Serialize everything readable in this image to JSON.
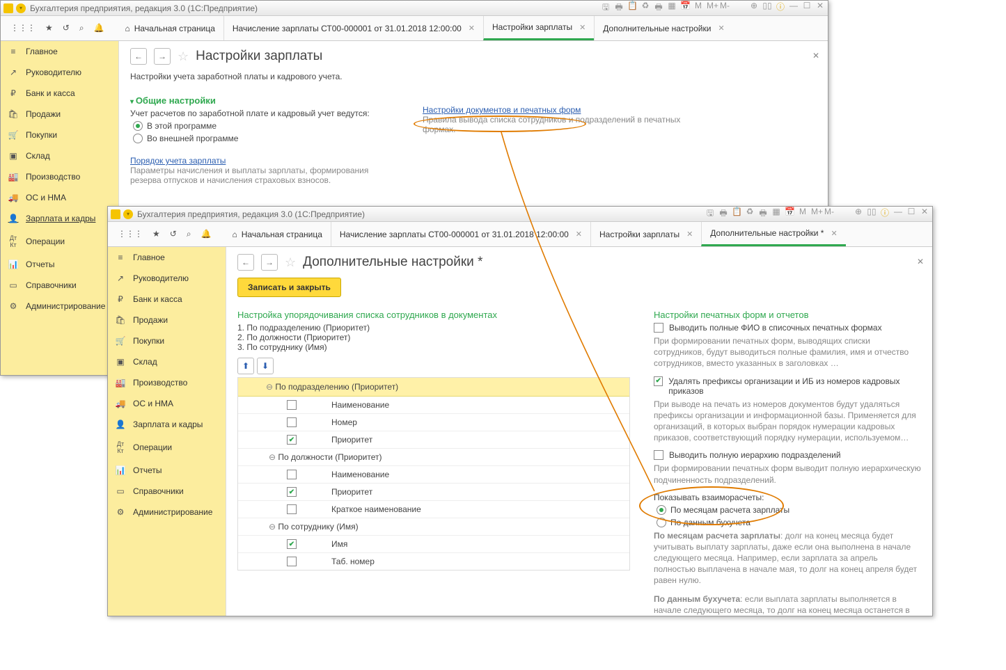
{
  "app_title": "Бухгалтерия предприятия, редакция 3.0  (1С:Предприятие)",
  "nav": {
    "home": "Начальная страница",
    "tab_payroll": "Начисление зарплаты СТ00-000001 от 31.01.2018 12:00:00",
    "tab_salary_settings": "Настройки зарплаты",
    "tab_additional": "Дополнительные настройки",
    "tab_additional_dirty": "Дополнительные настройки *"
  },
  "sidebar": {
    "main": "Главное",
    "manager": "Руководителю",
    "bank": "Банк и касса",
    "sales": "Продажи",
    "purchases": "Покупки",
    "warehouse": "Склад",
    "production": "Производство",
    "os": "ОС и НМА",
    "salary": "Зарплата и кадры",
    "operations": "Операции",
    "reports": "Отчеты",
    "ref": "Справочники",
    "admin": "Администрирование"
  },
  "page1": {
    "title": "Настройки зарплаты",
    "subtitle": "Настройки учета заработной платы и кадрового учета.",
    "section_general": "Общие настройки",
    "accounting_label": "Учет расчетов по заработной плате и кадровый учет ведутся:",
    "r1": "В этой программе",
    "r2": "Во внешней программе",
    "docs_link": "Настройки документов и печатных форм",
    "docs_hint": "Правила вывода списка сотрудников и подразделений в печатных формах.",
    "order_link": "Порядок учета зарплаты",
    "order_hint": "Параметры начисления и выплаты зарплаты, формирования резерва отпусков и начисления страховых взносов."
  },
  "page2": {
    "title": "Дополнительные настройки *",
    "save": "Записать и закрыть",
    "sort_title": "Настройка упорядочивания списка сотрудников в документах",
    "s1": "1. По подразделению (Приоритет)",
    "s2": "2. По должности (Приоритет)",
    "s3": "3. По сотруднику (Имя)",
    "g1": "По подразделению (Приоритет)",
    "g1_name": "Наименование",
    "g1_num": "Номер",
    "g1_pri": "Приоритет",
    "g2": "По должности (Приоритет)",
    "g2_name": "Наименование",
    "g2_pri": "Приоритет",
    "g2_short": "Краткое наименование",
    "g3": "По сотруднику (Имя)",
    "g3_name": "Имя",
    "g3_tab": "Таб. номер",
    "forms_title": "Настройки печатных форм и отчетов",
    "full_fio": "Выводить полные ФИО в списочных печатных формах",
    "full_fio_hint": "При формировании печатных форм, выводящих списки сотрудников, будут выводиться полные фамилия, имя и отчество сотрудников, вместо указанных в заголовках …",
    "prefix": "Удалять префиксы организации и ИБ из номеров кадровых приказов",
    "prefix_hint": "При выводе на печать из номеров документов будут удаляться префиксы организации и информационной базы. Применяется для организаций, в которых выбран порядок нумерации кадровых приказов, соответствующий порядку нумерации, используемом…",
    "hierarchy": "Выводить полную иерархию подразделений",
    "hierarchy_hint": "При формировании печатных форм выводит полную иерархическую подчиненность подразделений.",
    "show_settlements": "Показывать взаиморасчеты:",
    "opt_month": "По месяцам расчета зарплаты",
    "opt_acc": "По данным бухучета",
    "desc_month_b": "По месяцам расчета зарплаты",
    "desc_month": ": долг на конец месяца будет учитывать выплату зарплаты, даже если она выполнена в начале следующего месяца. Например, если зарплата за апрель полностью выплачена в начале мая, то долг на конец апреля будет равен нулю.",
    "desc_acc_b": "По данным бухучета",
    "desc_acc": ": если выплата зарплаты выполняется в начале следующего месяца, то долг на конец месяца останется в размере начисленной, но еще не выплаченной до выплаты зарплаты."
  }
}
